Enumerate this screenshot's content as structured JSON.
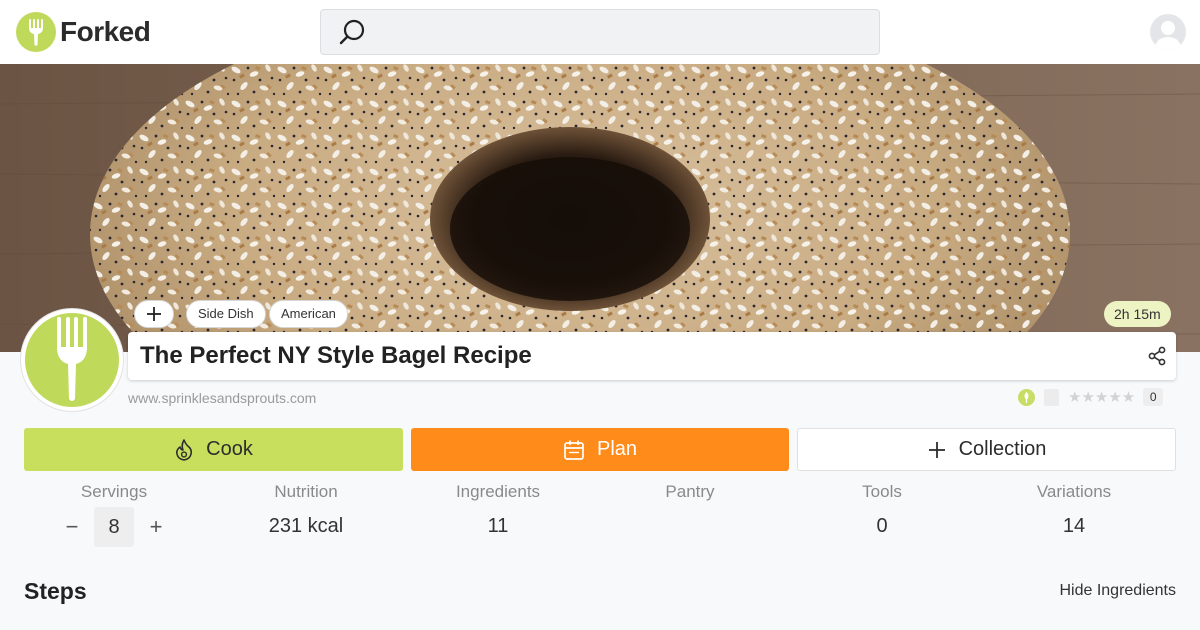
{
  "header": {
    "brand": "Forked",
    "search": {
      "placeholder": ""
    }
  },
  "recipe": {
    "tags": [
      "Side Dish",
      "American"
    ],
    "total_time": "2h 15m",
    "title": "The Perfect NY Style Bagel Recipe",
    "source": "www.sprinklesandsprouts.com",
    "rating": {
      "stars": "★★★★★",
      "count": "0"
    }
  },
  "actions": {
    "cook": "Cook",
    "plan": "Plan",
    "collection": "Collection"
  },
  "stats": {
    "servings": {
      "label": "Servings",
      "value": "8",
      "minus": "−",
      "plus": "+"
    },
    "nutrition": {
      "label": "Nutrition",
      "value": "231 kcal"
    },
    "ingredients": {
      "label": "Ingredients",
      "value": "11"
    },
    "pantry": {
      "label": "Pantry",
      "value": ""
    },
    "tools": {
      "label": "Tools",
      "value": "0"
    },
    "variations": {
      "label": "Variations",
      "value": "14"
    }
  },
  "steps": {
    "heading": "Steps",
    "hide_ingredients": "Hide Ingredients"
  },
  "icons": {
    "logo": "fork-icon",
    "search": "search-icon",
    "avatar": "user-icon",
    "add_tag": "plus-icon",
    "share": "share-icon",
    "cook": "flame-icon",
    "plan": "calendar-icon",
    "collection": "plus-icon"
  },
  "colors": {
    "brand_green": "#bfd95a",
    "plan_orange": "#ff8b1a",
    "time_badge": "#eef3c4"
  }
}
